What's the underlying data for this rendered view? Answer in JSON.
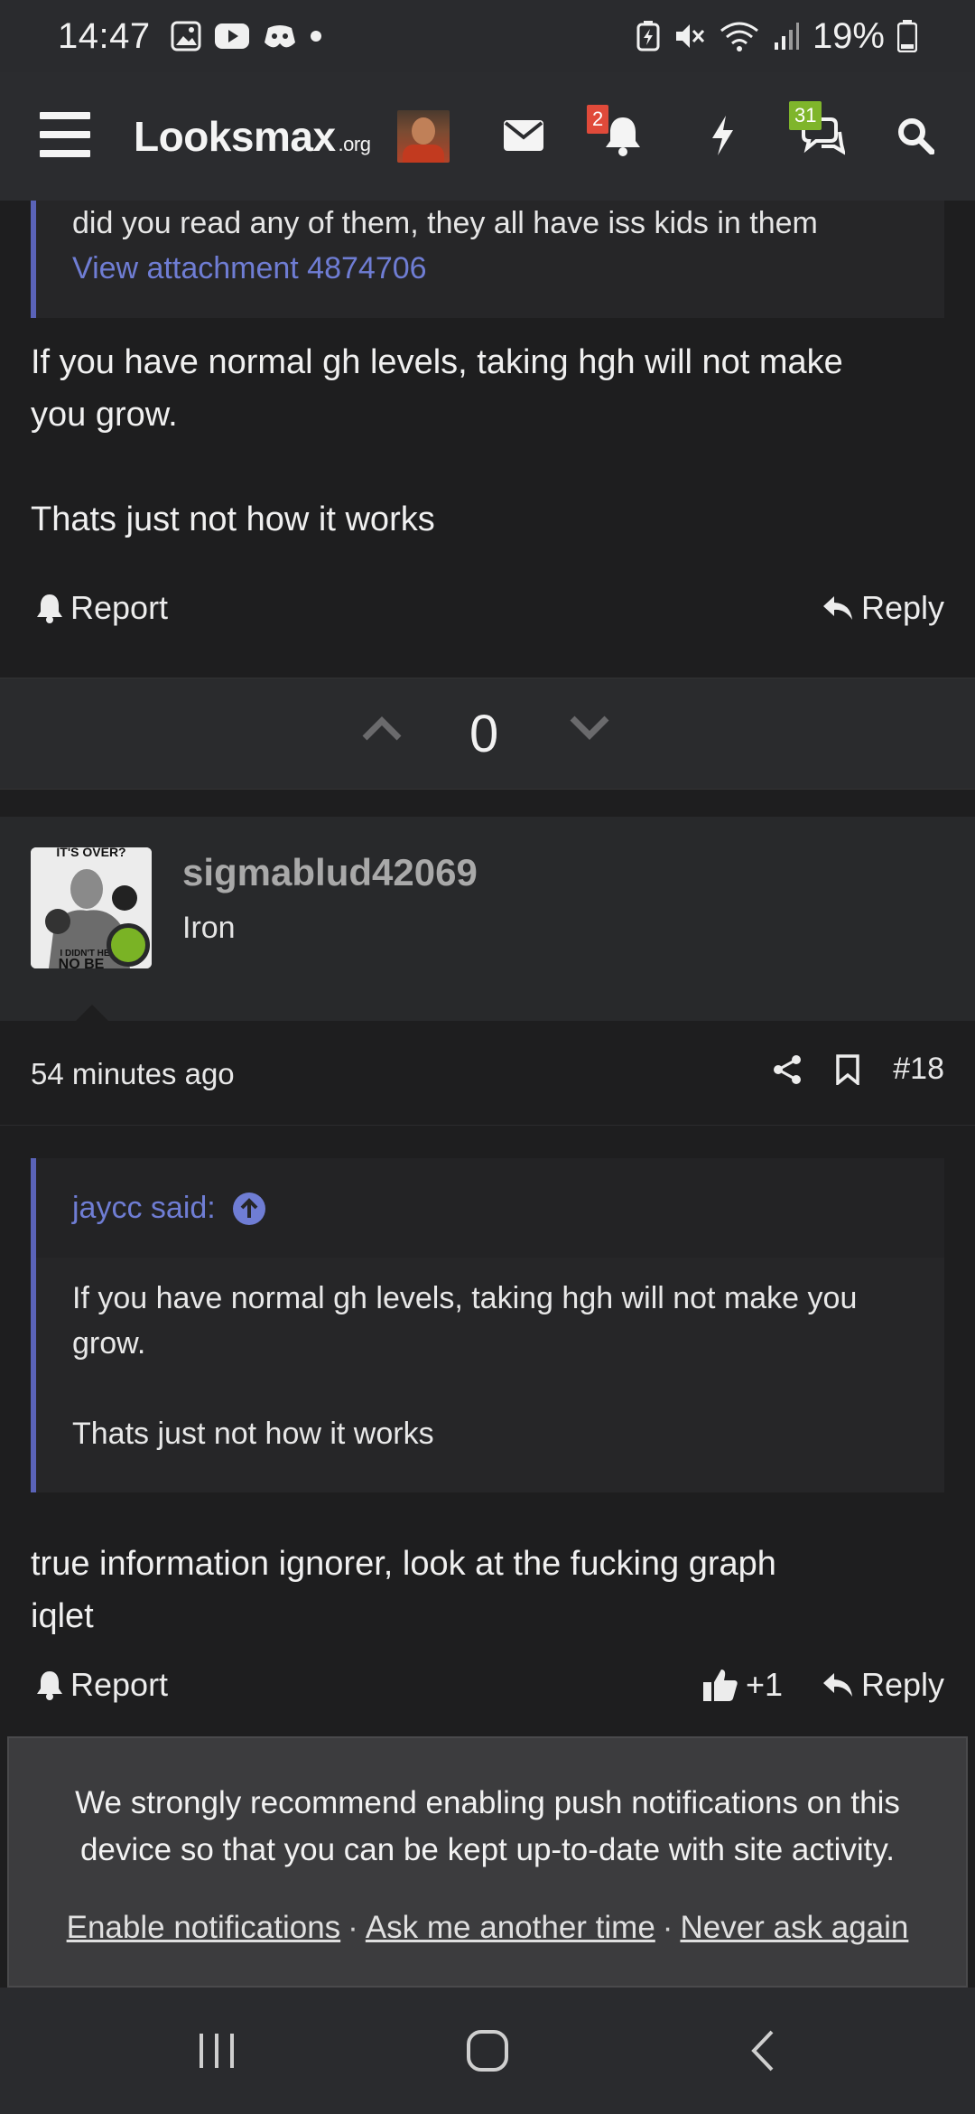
{
  "status_bar": {
    "time": "14:47",
    "battery": "19%",
    "icons_left": [
      "gallery-icon",
      "youtube-icon",
      "discord-icon",
      "dot-icon"
    ],
    "icons_right": [
      "battery-saver-icon",
      "mute-icon",
      "wifi-icon",
      "signal-icon",
      "battery-icon"
    ]
  },
  "navbar": {
    "logo_main": "Looksmax",
    "logo_suffix": ".org",
    "notifications_badge": "2",
    "conversations_badge": "31",
    "badge_colors": {
      "alerts": "#e04a3a",
      "conversations": "#7fb52b"
    }
  },
  "post_top": {
    "quote_line": "did you read any of them, they all have iss kids in them",
    "attachment_link": "View attachment 4874706",
    "body_line1": "If you have normal gh levels, taking hgh will not make",
    "body_line2": "you grow.",
    "body_line3": "Thats just not how it works",
    "report_label": "Report",
    "reply_label": "Reply"
  },
  "vote": {
    "count": "0"
  },
  "post": {
    "username": "sigmablud42069",
    "user_title": "Iron",
    "avatar_text_top": "IT'S OVER?",
    "avatar_text_bottom": "I DIDN'T HE",
    "avatar_text_bottom2": "NO BE",
    "time_ago": "54 minutes ago",
    "post_number": "#18",
    "quote_author": "jaycc said:",
    "quote_line1": "If you have normal gh levels, taking hgh will not make you",
    "quote_line2": "grow.",
    "quote_line3": "Thats just not how it works",
    "body_line1": "true information ignorer, look at the fucking graph",
    "body_line2": "iqlet",
    "report_label": "Report",
    "like_label": "+1",
    "reply_label": "Reply"
  },
  "push_banner": {
    "message_line1": "We strongly recommend enabling push notifications on this",
    "message_line2": "device so that you can be kept up-to-date with site activity.",
    "enable_label": "Enable notifications",
    "later_label": "Ask me another time",
    "never_label": "Never ask again",
    "separator": "·"
  },
  "system_nav": {
    "buttons": [
      "recents-icon",
      "home-icon",
      "back-icon"
    ]
  }
}
